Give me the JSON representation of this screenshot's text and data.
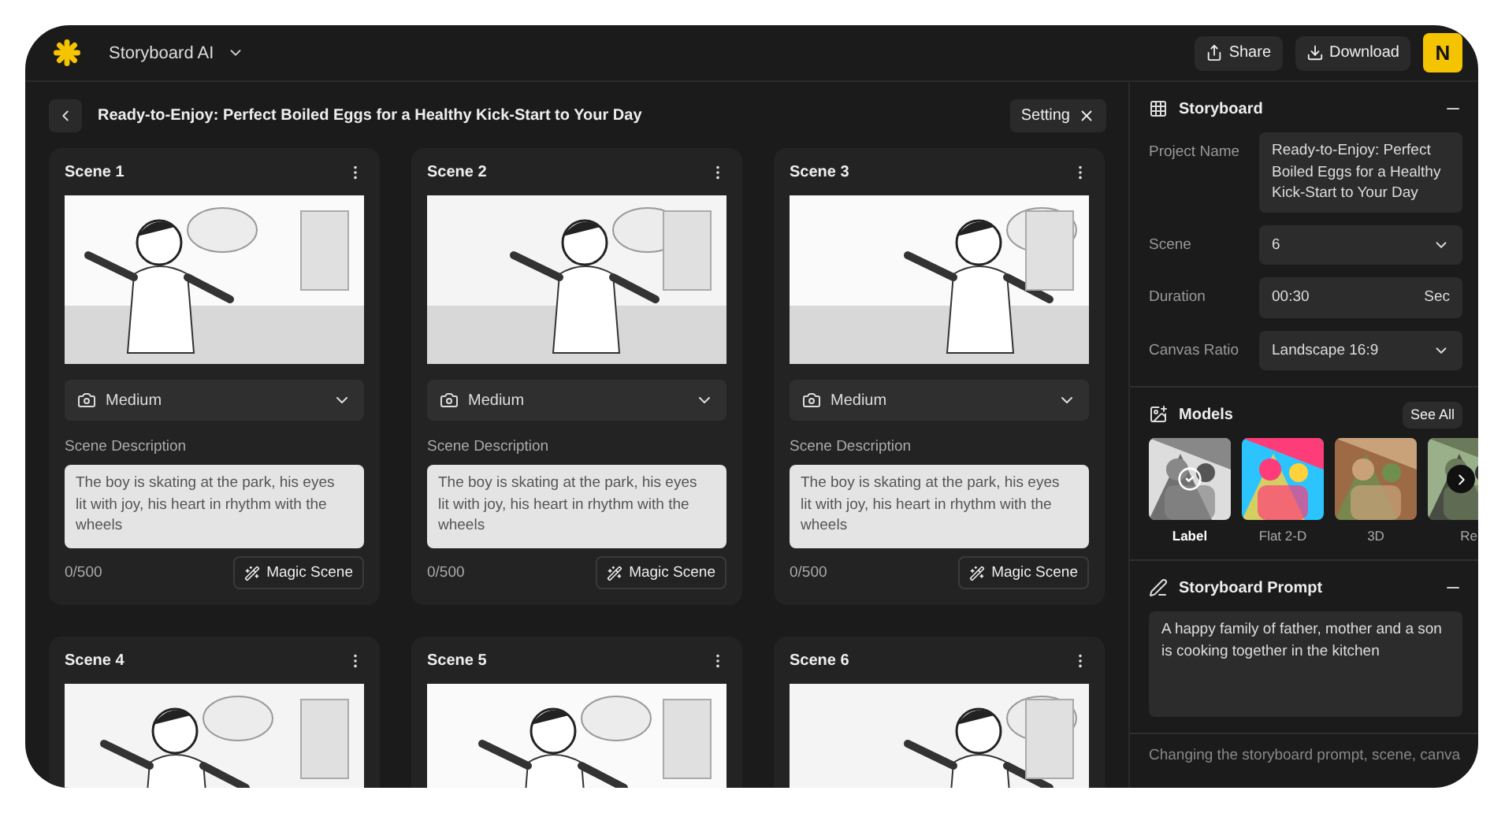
{
  "app": {
    "name": "Storyboard AI",
    "avatar": "N"
  },
  "header_actions": [
    {
      "kind": "share",
      "label": "Share"
    },
    {
      "kind": "download",
      "label": "Download"
    }
  ],
  "project_title": "Ready-to-Enjoy: Perfect Boiled Eggs for a Healthy Kick-Start to Your Day",
  "setting_button": "Setting",
  "scenes": [
    {
      "title": "Scene 1",
      "shot": "Medium",
      "description_label": "Scene Description",
      "description": "The boy is skating at the park, his eyes lit with joy, his heart in rhythm with the wheels",
      "counter": "0/500",
      "magic_button": "Magic Scene"
    },
    {
      "title": "Scene 2",
      "shot": "Medium",
      "description_label": "Scene Description",
      "description": "The boy is skating at the park, his eyes lit with joy, his heart in rhythm with the wheels",
      "counter": "0/500",
      "magic_button": "Magic Scene"
    },
    {
      "title": "Scene 3",
      "shot": "Medium",
      "description_label": "Scene Description",
      "description": "The boy is skating at the park, his eyes lit with joy, his heart in rhythm with the wheels",
      "counter": "0/500",
      "magic_button": "Magic Scene"
    },
    {
      "title": "Scene 4"
    },
    {
      "title": "Scene 5"
    },
    {
      "title": "Scene 6"
    }
  ],
  "storyboard": {
    "title": "Storyboard",
    "fields": [
      {
        "kind": "textarea",
        "label": "Project Name",
        "value": "Ready-to-Enjoy: Perfect Boiled Eggs for a Healthy Kick-Start to Your Day"
      },
      {
        "kind": "select",
        "label": "Scene",
        "value": "6"
      },
      {
        "kind": "duration",
        "label": "Duration",
        "value": "00:30",
        "unit": "Sec"
      },
      {
        "kind": "select",
        "label": "Canvas Ratio",
        "value": "Landscape 16:9"
      }
    ]
  },
  "models": {
    "title": "Models",
    "see_all": "See All",
    "items": [
      {
        "label": "Label",
        "selected": true
      },
      {
        "label": "Flat 2-D",
        "selected": false
      },
      {
        "label": "3D",
        "selected": false
      },
      {
        "label": "Re",
        "selected": false
      }
    ]
  },
  "prompt": {
    "title": "Storyboard Prompt",
    "text": "A happy family of father, mother and a son is cooking together in the kitchen"
  },
  "note": "Changing the storyboard prompt, scene, canva"
}
